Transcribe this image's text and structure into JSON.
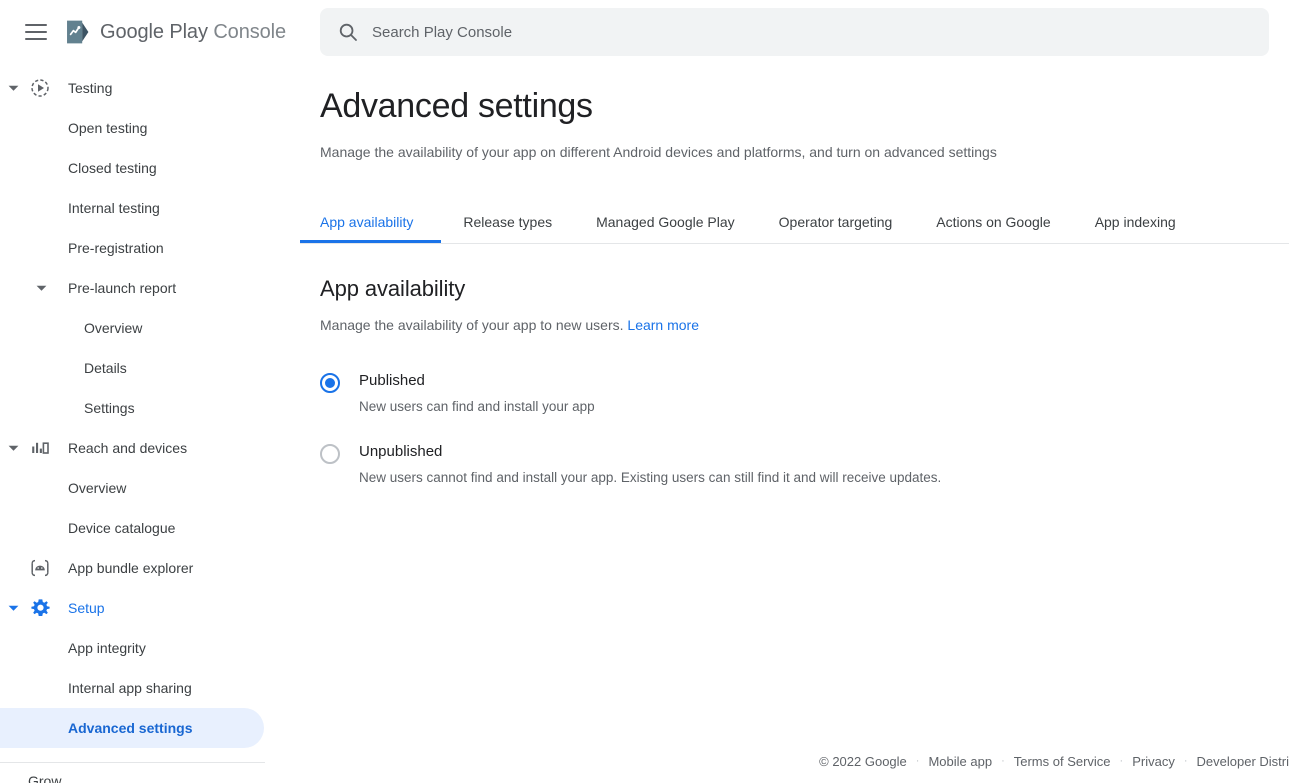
{
  "brand": {
    "logo_icon": "google-play-console-logo",
    "name_primary": "Google Play",
    "name_secondary": "Console",
    "menu_icon": "hamburger-menu-icon"
  },
  "search": {
    "placeholder": "Search Play Console",
    "value": "",
    "icon": "search-icon"
  },
  "sidebar": {
    "items": [
      {
        "label": "Testing",
        "level": 1,
        "icon": "testing-play-icon",
        "expanded": true,
        "state": "section"
      },
      {
        "label": "Open testing",
        "level": 2,
        "icon": "",
        "expanded": null,
        "state": "normal"
      },
      {
        "label": "Closed testing",
        "level": 2,
        "icon": "",
        "expanded": null,
        "state": "normal"
      },
      {
        "label": "Internal testing",
        "level": 2,
        "icon": "",
        "expanded": null,
        "state": "normal"
      },
      {
        "label": "Pre-registration",
        "level": 2,
        "icon": "",
        "expanded": null,
        "state": "normal"
      },
      {
        "label": "Pre-launch report",
        "level": 2,
        "icon": "",
        "expanded": true,
        "state": "normal"
      },
      {
        "label": "Overview",
        "level": 3,
        "icon": "",
        "expanded": null,
        "state": "normal"
      },
      {
        "label": "Details",
        "level": 3,
        "icon": "",
        "expanded": null,
        "state": "normal"
      },
      {
        "label": "Settings",
        "level": 3,
        "icon": "",
        "expanded": null,
        "state": "normal"
      },
      {
        "label": "Reach and devices",
        "level": 1,
        "icon": "bar-chart-icon",
        "expanded": true,
        "state": "section"
      },
      {
        "label": "Overview",
        "level": 2,
        "icon": "",
        "expanded": null,
        "state": "normal"
      },
      {
        "label": "Device catalogue",
        "level": 2,
        "icon": "",
        "expanded": null,
        "state": "normal"
      },
      {
        "label": "App bundle explorer",
        "level": 1,
        "icon": "app-bundle-android-icon",
        "expanded": null,
        "state": "normal"
      },
      {
        "label": "Setup",
        "level": 1,
        "icon": "gear-icon",
        "expanded": true,
        "state": "active-blue"
      },
      {
        "label": "App integrity",
        "level": 2,
        "icon": "",
        "expanded": null,
        "state": "normal"
      },
      {
        "label": "Internal app sharing",
        "level": 2,
        "icon": "",
        "expanded": null,
        "state": "normal"
      },
      {
        "label": "Advanced settings",
        "level": 2,
        "icon": "",
        "expanded": null,
        "state": "selected"
      }
    ],
    "footer_group_label": "Grow"
  },
  "page": {
    "title": "Advanced settings",
    "subtitle": "Manage the availability of your app on different Android devices and platforms, and turn on advanced settings"
  },
  "tabs": [
    {
      "label": "App availability",
      "active": true
    },
    {
      "label": "Release types",
      "active": false
    },
    {
      "label": "Managed Google Play",
      "active": false
    },
    {
      "label": "Operator targeting",
      "active": false
    },
    {
      "label": "Actions on Google",
      "active": false
    },
    {
      "label": "App indexing",
      "active": false
    }
  ],
  "section": {
    "title": "App availability",
    "description": "Manage the availability of your app to new users.",
    "learn_more_label": "Learn more"
  },
  "availability_options": [
    {
      "label": "Published",
      "description": "New users can find and install your app",
      "selected": true
    },
    {
      "label": "Unpublished",
      "description": "New users cannot find and install your app. Existing users can still find it and will receive updates.",
      "selected": false
    }
  ],
  "footer": {
    "copyright": "© 2022 Google",
    "links": [
      "Mobile app",
      "Terms of Service",
      "Privacy",
      "Developer Distri"
    ],
    "separator": "·"
  },
  "colors": {
    "accent_blue": "#1a73e8",
    "selected_pill_bg": "#e8f0fe",
    "selected_text": "#1967d2",
    "text_primary": "#202124",
    "text_secondary": "#5f6368",
    "search_bg": "#f1f3f4"
  }
}
